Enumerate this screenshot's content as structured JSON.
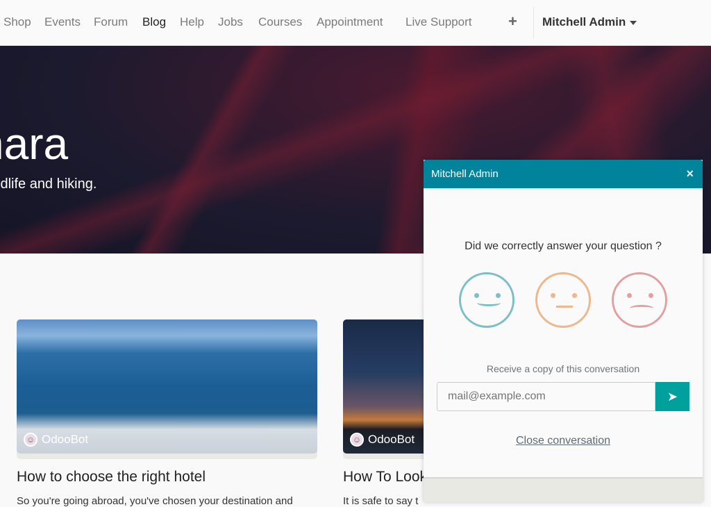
{
  "nav": {
    "items": [
      {
        "label": "Shop"
      },
      {
        "label": "Events"
      },
      {
        "label": "Forum"
      },
      {
        "label": "Blog",
        "active": true
      },
      {
        "label": "Help"
      },
      {
        "label": "Jobs"
      },
      {
        "label": "Courses"
      },
      {
        "label": "Appointment"
      },
      {
        "label": "Live Support"
      }
    ],
    "plus_icon": "plus-icon",
    "user": "Mitchell Admin"
  },
  "hero": {
    "title": "hara",
    "subtitle": "ldlife and hiking."
  },
  "posts": [
    {
      "author": "OdooBot",
      "title": "How to choose the right hotel",
      "excerpt": "So you're going abroad, you've chosen your destination and"
    },
    {
      "author": "OdooBot",
      "title": "How To Look",
      "excerpt": "It is safe to say t"
    }
  ],
  "chat": {
    "title": "Mitchell Admin",
    "question": "Did we correctly answer your question ?",
    "ratings": [
      {
        "icon": "happy-face-icon",
        "color": "#7cbfc6"
      },
      {
        "icon": "neutral-face-icon",
        "color": "#ecb88c"
      },
      {
        "icon": "sad-face-icon",
        "color": "#dea2a2"
      }
    ],
    "copy_label": "Receive a copy of this conversation",
    "email_placeholder": "mail@example.com",
    "close_label": "Close conversation",
    "header_color": "#00839b",
    "send_color": "#00a09d"
  }
}
